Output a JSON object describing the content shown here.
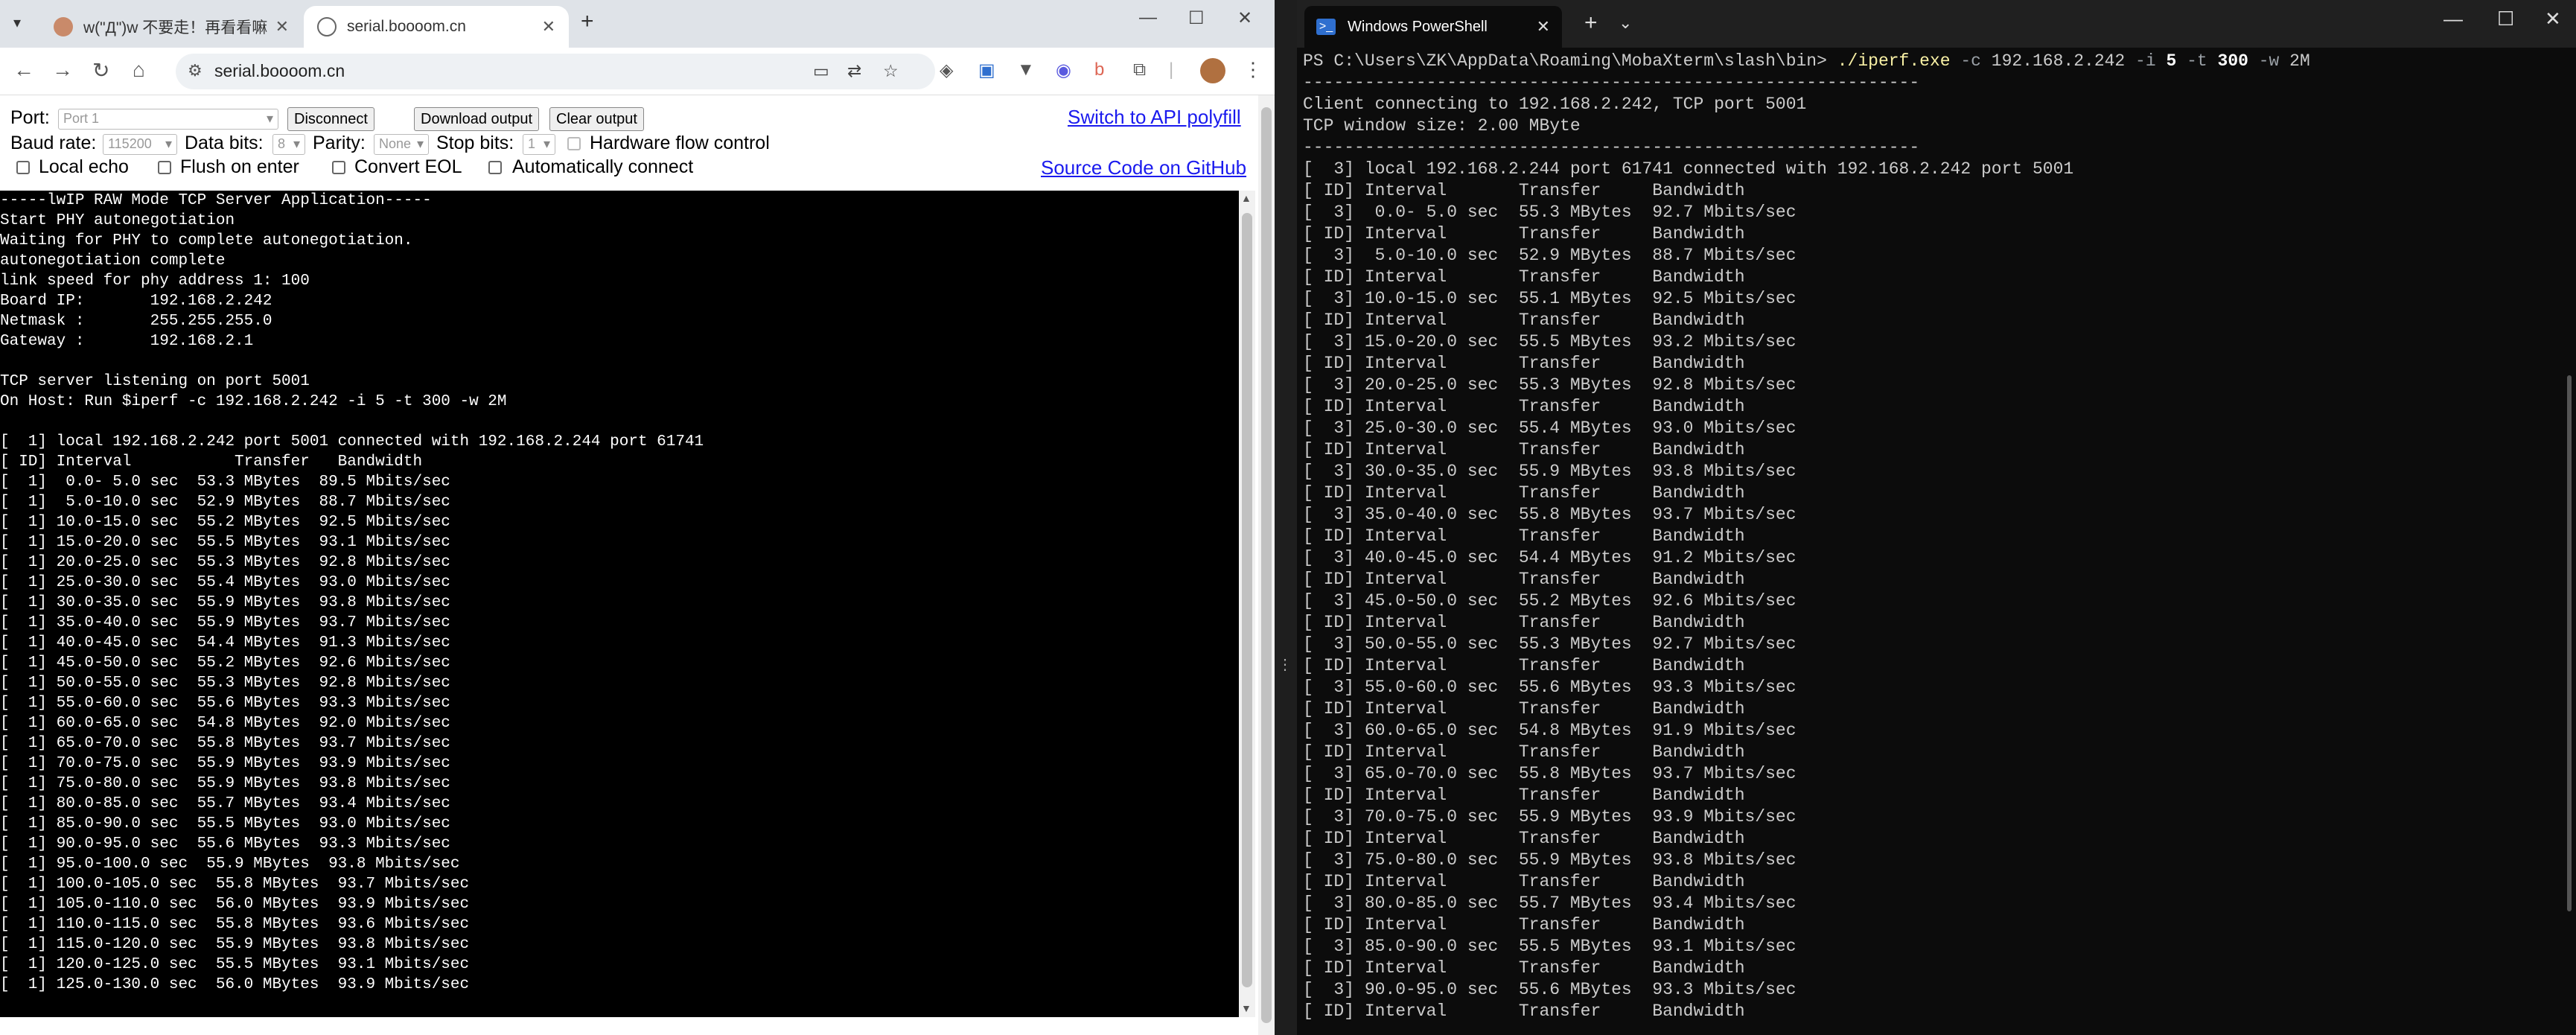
{
  "browser": {
    "tabs": [
      {
        "title": "w(\"Д\")w 不要走！再看看嘛！",
        "favicon": "cat-avatar-icon"
      },
      {
        "title": "serial.boooom.cn",
        "favicon": "globe-icon"
      }
    ],
    "url": "serial.boooom.cn",
    "controls": {
      "port_label": "Port:",
      "port_value": "Port 1",
      "disconnect": "Disconnect",
      "download_output": "Download output",
      "clear_output": "Clear output",
      "switch_api": "Switch to API polyfill",
      "baud_label": "Baud rate:",
      "baud_value": "115200",
      "databits_label": "Data bits:",
      "databits_value": "8",
      "parity_label": "Parity:",
      "parity_value": "None",
      "stopbits_label": "Stop bits:",
      "stopbits_value": "1",
      "hw_flow": "Hardware flow control",
      "local_echo": "Local echo",
      "flush_on_enter": "Flush on enter",
      "convert_eol": "Convert EOL",
      "auto_connect": "Automatically connect",
      "source_code": "Source Code on GitHub"
    },
    "terminal_lines": [
      "-----lwIP RAW Mode TCP Server Application-----",
      "Start PHY autonegotiation",
      "Waiting for PHY to complete autonegotiation.",
      "autonegotiation complete",
      "link speed for phy address 1: 100",
      "Board IP:       192.168.2.242",
      "Netmask :       255.255.255.0",
      "Gateway :       192.168.2.1",
      "",
      "TCP server listening on port 5001",
      "On Host: Run $iperf -c 192.168.2.242 -i 5 -t 300 -w 2M",
      "",
      "[  1] local 192.168.2.242 port 5001 connected with 192.168.2.244 port 61741",
      "[ ID] Interval           Transfer   Bandwidth",
      "[  1]  0.0- 5.0 sec  53.3 MBytes  89.5 Mbits/sec",
      "[  1]  5.0-10.0 sec  52.9 MBytes  88.7 Mbits/sec",
      "[  1] 10.0-15.0 sec  55.2 MBytes  92.5 Mbits/sec",
      "[  1] 15.0-20.0 sec  55.5 MBytes  93.1 Mbits/sec",
      "[  1] 20.0-25.0 sec  55.3 MBytes  92.8 Mbits/sec",
      "[  1] 25.0-30.0 sec  55.4 MBytes  93.0 Mbits/sec",
      "[  1] 30.0-35.0 sec  55.9 MBytes  93.8 Mbits/sec",
      "[  1] 35.0-40.0 sec  55.9 MBytes  93.7 Mbits/sec",
      "[  1] 40.0-45.0 sec  54.4 MBytes  91.3 Mbits/sec",
      "[  1] 45.0-50.0 sec  55.2 MBytes  92.6 Mbits/sec",
      "[  1] 50.0-55.0 sec  55.3 MBytes  92.8 Mbits/sec",
      "[  1] 55.0-60.0 sec  55.6 MBytes  93.3 Mbits/sec",
      "[  1] 60.0-65.0 sec  54.8 MBytes  92.0 Mbits/sec",
      "[  1] 65.0-70.0 sec  55.8 MBytes  93.7 Mbits/sec",
      "[  1] 70.0-75.0 sec  55.9 MBytes  93.9 Mbits/sec",
      "[  1] 75.0-80.0 sec  55.9 MBytes  93.8 Mbits/sec",
      "[  1] 80.0-85.0 sec  55.7 MBytes  93.4 Mbits/sec",
      "[  1] 85.0-90.0 sec  55.5 MBytes  93.0 Mbits/sec",
      "[  1] 90.0-95.0 sec  55.6 MBytes  93.3 Mbits/sec",
      "[  1] 95.0-100.0 sec  55.9 MBytes  93.8 Mbits/sec",
      "[  1] 100.0-105.0 sec  55.8 MBytes  93.7 Mbits/sec",
      "[  1] 105.0-110.0 sec  56.0 MBytes  93.9 Mbits/sec",
      "[  1] 110.0-115.0 sec  55.8 MBytes  93.6 Mbits/sec",
      "[  1] 115.0-120.0 sec  55.9 MBytes  93.8 Mbits/sec",
      "[  1] 120.0-125.0 sec  55.5 MBytes  93.1 Mbits/sec",
      "[  1] 125.0-130.0 sec  56.0 MBytes  93.9 Mbits/sec"
    ]
  },
  "powershell": {
    "tab_title": "Windows PowerShell",
    "prompt": "PS C:\\Users\\ZK\\AppData\\Roaming\\MobaXterm\\slash\\bin>",
    "command": "./iperf.exe",
    "args": [
      {
        "t": "-c",
        "k": "fl"
      },
      {
        "t": "192.168.2.242",
        "k": ""
      },
      {
        "t": "-i",
        "k": "fl"
      },
      {
        "t": "5",
        "k": "num"
      },
      {
        "t": "-t",
        "k": "fl"
      },
      {
        "t": "300",
        "k": "num"
      },
      {
        "t": "-w",
        "k": "fl"
      },
      {
        "t": "2M",
        "k": ""
      }
    ],
    "lines": [
      "------------------------------------------------------------",
      "Client connecting to 192.168.2.242, TCP port 5001",
      "TCP window size: 2.00 MByte",
      "------------------------------------------------------------",
      "[  3] local 192.168.2.244 port 61741 connected with 192.168.2.242 port 5001",
      "[ ID] Interval       Transfer     Bandwidth",
      "[  3]  0.0- 5.0 sec  55.3 MBytes  92.7 Mbits/sec",
      "[ ID] Interval       Transfer     Bandwidth",
      "[  3]  5.0-10.0 sec  52.9 MBytes  88.7 Mbits/sec",
      "[ ID] Interval       Transfer     Bandwidth",
      "[  3] 10.0-15.0 sec  55.1 MBytes  92.5 Mbits/sec",
      "[ ID] Interval       Transfer     Bandwidth",
      "[  3] 15.0-20.0 sec  55.5 MBytes  93.2 Mbits/sec",
      "[ ID] Interval       Transfer     Bandwidth",
      "[  3] 20.0-25.0 sec  55.3 MBytes  92.8 Mbits/sec",
      "[ ID] Interval       Transfer     Bandwidth",
      "[  3] 25.0-30.0 sec  55.4 MBytes  93.0 Mbits/sec",
      "[ ID] Interval       Transfer     Bandwidth",
      "[  3] 30.0-35.0 sec  55.9 MBytes  93.8 Mbits/sec",
      "[ ID] Interval       Transfer     Bandwidth",
      "[  3] 35.0-40.0 sec  55.8 MBytes  93.7 Mbits/sec",
      "[ ID] Interval       Transfer     Bandwidth",
      "[  3] 40.0-45.0 sec  54.4 MBytes  91.2 Mbits/sec",
      "[ ID] Interval       Transfer     Bandwidth",
      "[  3] 45.0-50.0 sec  55.2 MBytes  92.6 Mbits/sec",
      "[ ID] Interval       Transfer     Bandwidth",
      "[  3] 50.0-55.0 sec  55.3 MBytes  92.7 Mbits/sec",
      "[ ID] Interval       Transfer     Bandwidth",
      "[  3] 55.0-60.0 sec  55.6 MBytes  93.3 Mbits/sec",
      "[ ID] Interval       Transfer     Bandwidth",
      "[  3] 60.0-65.0 sec  54.8 MBytes  91.9 Mbits/sec",
      "[ ID] Interval       Transfer     Bandwidth",
      "[  3] 65.0-70.0 sec  55.8 MBytes  93.7 Mbits/sec",
      "[ ID] Interval       Transfer     Bandwidth",
      "[  3] 70.0-75.0 sec  55.9 MBytes  93.9 Mbits/sec",
      "[ ID] Interval       Transfer     Bandwidth",
      "[  3] 75.0-80.0 sec  55.9 MBytes  93.8 Mbits/sec",
      "[ ID] Interval       Transfer     Bandwidth",
      "[  3] 80.0-85.0 sec  55.7 MBytes  93.4 Mbits/sec",
      "[ ID] Interval       Transfer     Bandwidth",
      "[  3] 85.0-90.0 sec  55.5 MBytes  93.1 Mbits/sec",
      "[ ID] Interval       Transfer     Bandwidth",
      "[  3] 90.0-95.0 sec  55.6 MBytes  93.3 Mbits/sec",
      "[ ID] Interval       Transfer     Bandwidth"
    ]
  }
}
